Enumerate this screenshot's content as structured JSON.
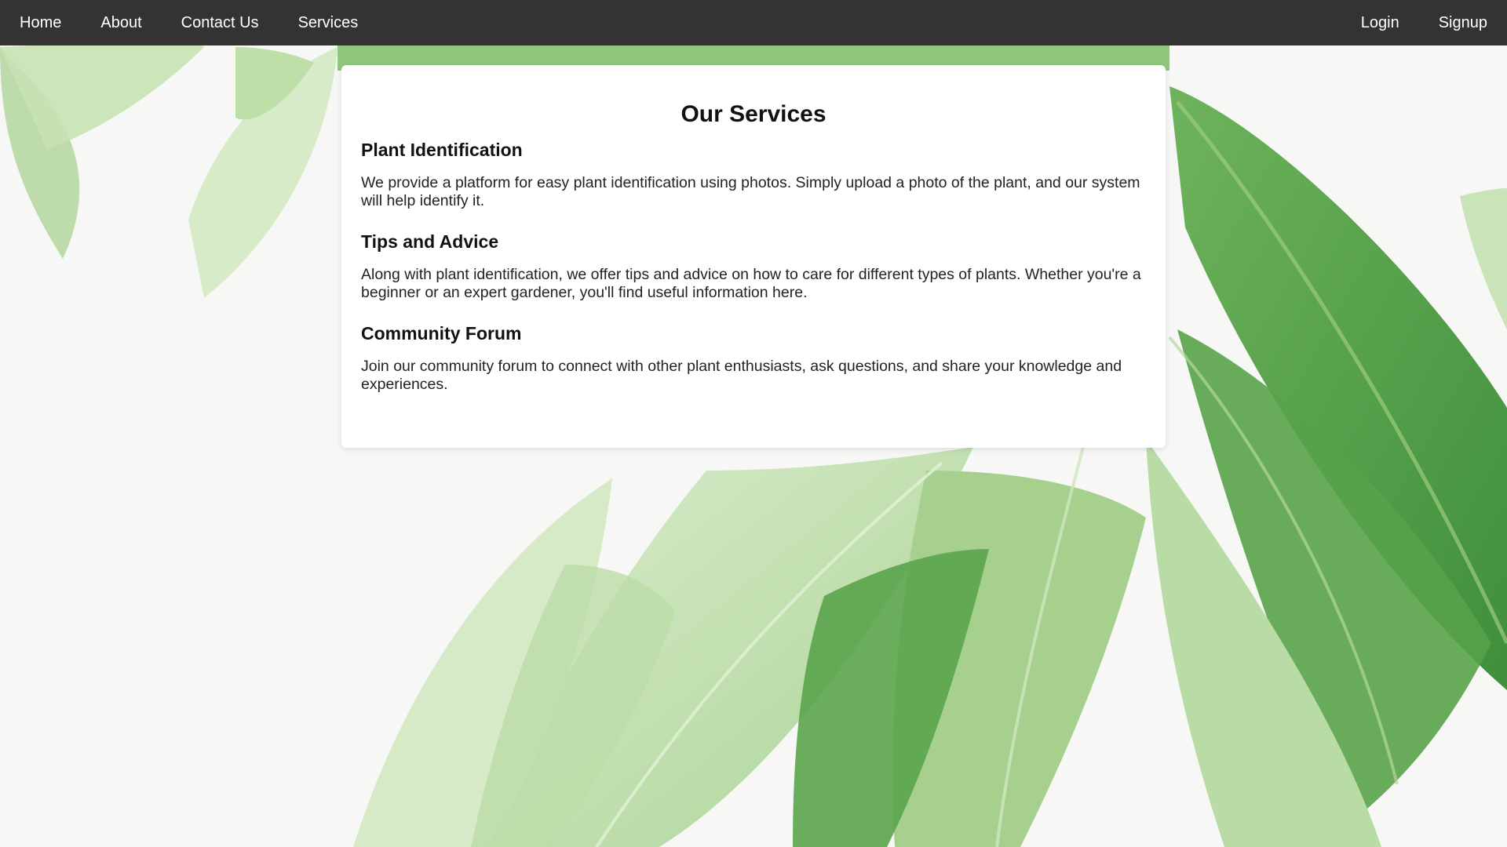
{
  "nav": {
    "left": [
      "Home",
      "About",
      "Contact Us",
      "Services"
    ],
    "right": [
      "Login",
      "Signup"
    ]
  },
  "main": {
    "title": "Our Services",
    "services": [
      {
        "heading": "Plant Identification",
        "text": "We provide a platform for easy plant identification using photos. Simply upload a photo of the plant, and our system will help identify it."
      },
      {
        "heading": "Tips and Advice",
        "text": "Along with plant identification, we offer tips and advice on how to care for different types of plants. Whether you're a beginner or an expert gardener, you'll find useful information here."
      },
      {
        "heading": "Community Forum",
        "text": "Join our community forum to connect with other plant enthusiasts, ask questions, and share your knowledge and experiences."
      }
    ]
  },
  "colors": {
    "navbar": "#333333",
    "nav_text": "#ffffff",
    "card": "#ffffff",
    "background": "#f7f8f6",
    "leaf_light": "#cfe4bd",
    "leaf_mid": "#9fcf8a",
    "leaf_dark": "#5fa64f"
  },
  "background_image": "green-leaves-photo"
}
